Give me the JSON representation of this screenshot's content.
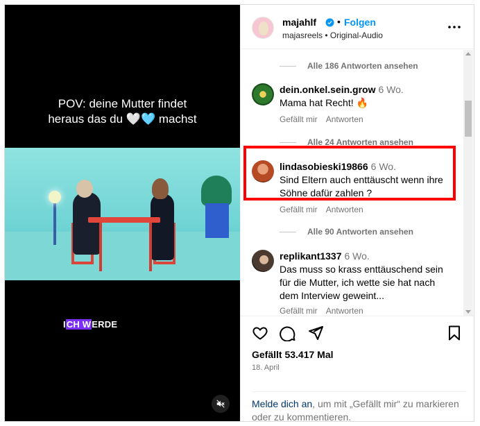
{
  "video": {
    "caption_line1": "POV: deine Mutter findet",
    "caption_line2": "heraus das du 🤍🩵 machst",
    "subtitle_pre": "I",
    "subtitle_hl": "CH W",
    "subtitle_post": "ERDE",
    "mute_icon": "speaker-muted-icon"
  },
  "post": {
    "username": "majahlf",
    "follow_label": "Folgen",
    "subline": "majasreels • Original-Audio",
    "likes": "Gefällt 53.417 Mal",
    "date": "18. April"
  },
  "comments": [
    {
      "type": "replies",
      "label": "Alle 186 Antworten ansehen"
    },
    {
      "type": "comment",
      "user": "dein.onkel.sein.grow",
      "time": "6 Wo.",
      "text": "Mama hat Recht! 🔥",
      "like": "Gefällt mir",
      "reply": "Antworten"
    },
    {
      "type": "replies",
      "label": "Alle 24 Antworten ansehen"
    },
    {
      "type": "comment",
      "user": "lindasobieski19866",
      "time": "6 Wo.",
      "text": "Sind Eltern auch enttäuscht wenn ihre Söhne dafür zahlen ?",
      "like": "Gefällt mir",
      "reply": "Antworten"
    },
    {
      "type": "replies",
      "label": "Alle 90 Antworten ansehen"
    },
    {
      "type": "comment",
      "user": "replikant1337",
      "time": "6 Wo.",
      "text": "Das muss so krass enttäuschend sein für die Mutter, ich wette sie hat nach dem Interview geweint...",
      "like": "Gefällt mir",
      "reply": "Antworten"
    }
  ],
  "login_prompt": {
    "link": "Melde dich an",
    "rest": ", um mit „Gefällt mir“ zu markieren oder zu kommentieren."
  },
  "colors": {
    "accent": "#0095f6",
    "highlight": "#ff0000",
    "subtitle_highlight": "#7b2ff7"
  }
}
